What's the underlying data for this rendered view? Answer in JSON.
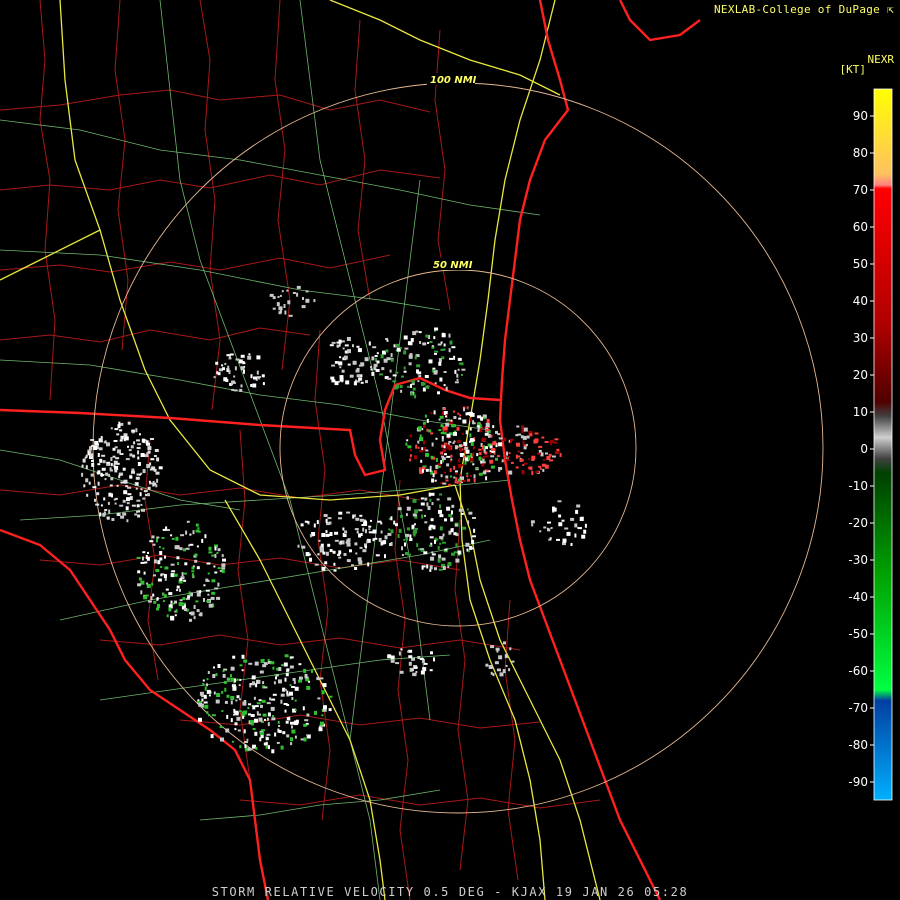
{
  "credit": "NEXLAB-College of DuPage",
  "credit_icon": "cursor-arrow-icon",
  "legend": {
    "product": "NEXR",
    "unit": "[KT]",
    "ticks": [
      "90",
      "80",
      "70",
      "60",
      "50",
      "40",
      "30",
      "20",
      "10",
      "0",
      "-10",
      "-20",
      "-30",
      "-40",
      "-50",
      "-60",
      "-70",
      "-80",
      "-90"
    ]
  },
  "range_rings": [
    {
      "label": "100 NMI"
    },
    {
      "label": "50 NMI"
    }
  ],
  "caption": "STORM RELATIVE VELOCITY 0.5 DEG - KJAX 19 JAN 26 05:28",
  "colors": {
    "background": "#000000",
    "state_borders": "#ff2020",
    "county_borders": "#b01818",
    "highways": "#e8e840",
    "roads": "#90e090",
    "rings": "#e8b890"
  }
}
